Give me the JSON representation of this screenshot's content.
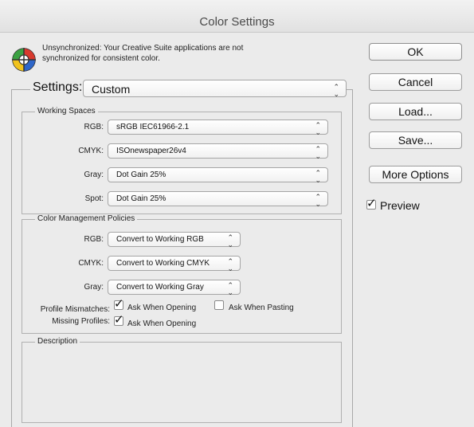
{
  "window": {
    "title": "Color Settings"
  },
  "warning": {
    "line1": "Unsynchronized: Your Creative Suite applications are not",
    "line2": "synchronized for consistent color."
  },
  "settings": {
    "label": "Settings:",
    "value": "Custom"
  },
  "working_spaces": {
    "title": "Working Spaces",
    "rows": [
      {
        "label": "RGB:",
        "value": "sRGB IEC61966-2.1"
      },
      {
        "label": "CMYK:",
        "value": "ISOnewspaper26v4"
      },
      {
        "label": "Gray:",
        "value": "Dot Gain 25%"
      },
      {
        "label": "Spot:",
        "value": "Dot Gain 25%"
      }
    ]
  },
  "policies": {
    "title": "Color Management Policies",
    "rows": [
      {
        "label": "RGB:",
        "value": "Convert to Working RGB"
      },
      {
        "label": "CMYK:",
        "value": "Convert to Working CMYK"
      },
      {
        "label": "Gray:",
        "value": "Convert to Working Gray"
      }
    ],
    "profile_mismatches": {
      "label": "Profile Mismatches:",
      "ask_opening": {
        "label": "Ask When Opening",
        "checked": true
      },
      "ask_pasting": {
        "label": "Ask When Pasting",
        "checked": false
      }
    },
    "missing_profiles": {
      "label": "Missing Profiles:",
      "ask_opening": {
        "label": "Ask When Opening",
        "checked": true
      }
    }
  },
  "description": {
    "title": "Description"
  },
  "buttons": {
    "ok": "OK",
    "cancel": "Cancel",
    "load": "Load...",
    "save": "Save...",
    "more_options": "More Options"
  },
  "preview": {
    "label": "Preview",
    "checked": true
  },
  "colors": {
    "accent_blue": "#1f5fbf",
    "window_bg": "#ebebeb"
  },
  "icons": {
    "arrows": "⌃⌄",
    "check": "✓"
  }
}
